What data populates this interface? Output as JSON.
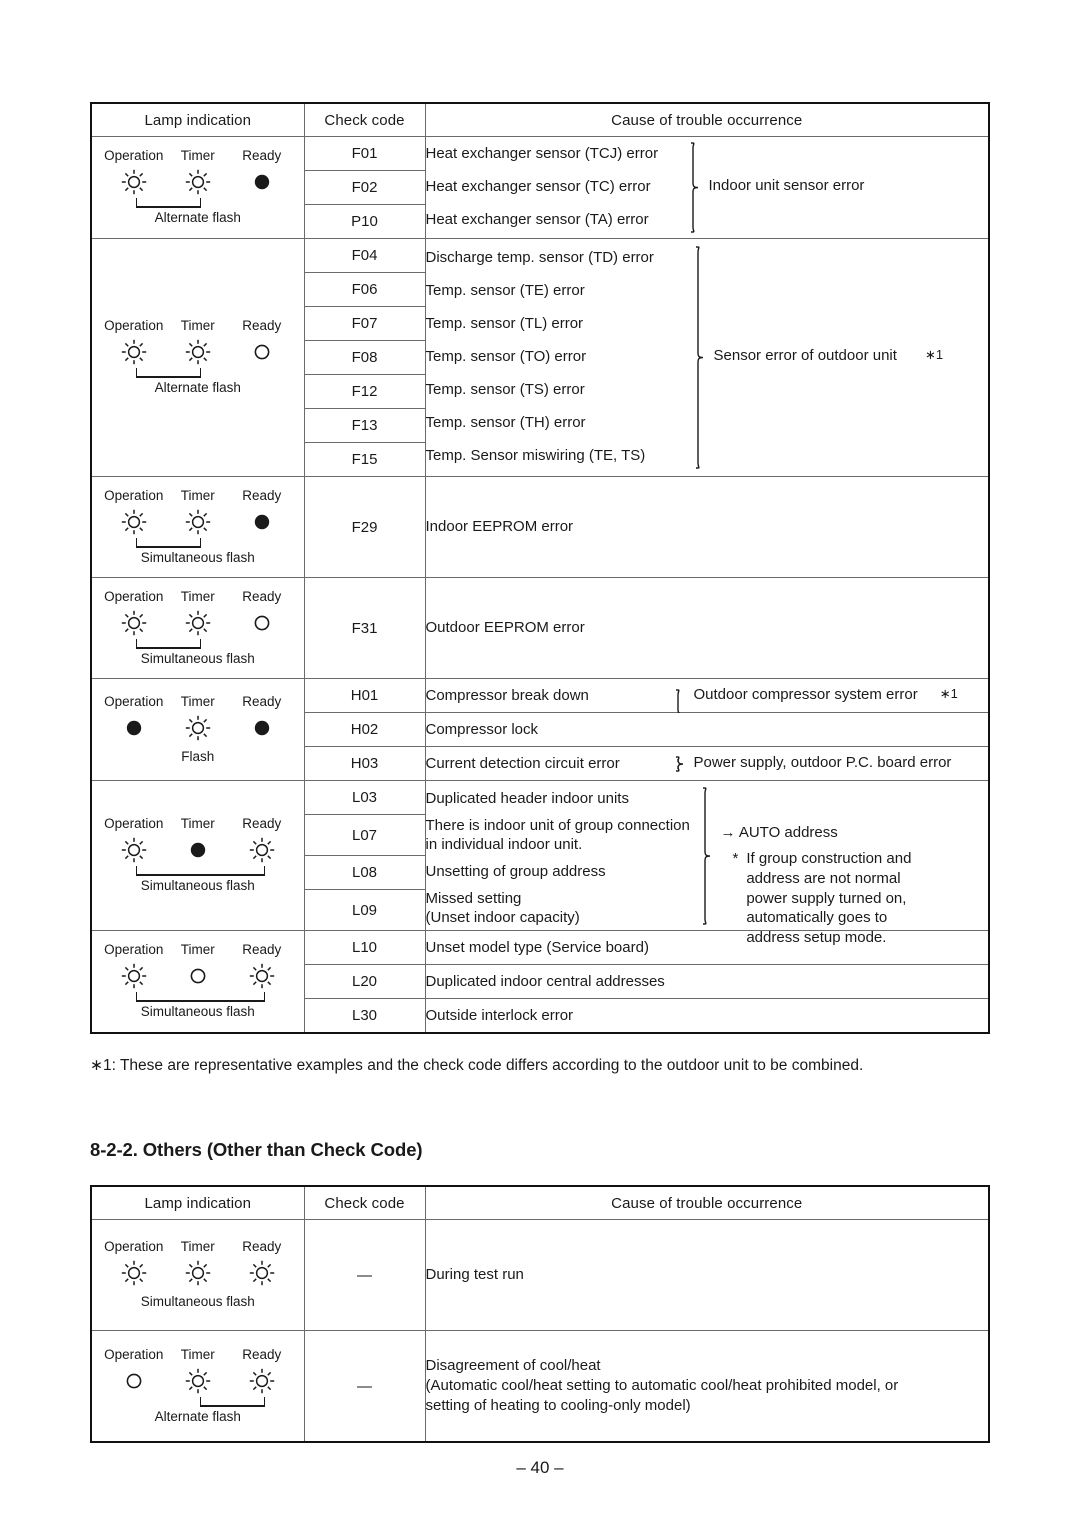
{
  "page": {
    "number": "– 40 –"
  },
  "table1": {
    "name": "check-code-table",
    "headers": [
      "Lamp indication",
      "Check code",
      "Cause of trouble occurrence"
    ],
    "groups": [
      {
        "id": "group-indoor-sensor",
        "lamp": {
          "labels": [
            "Operation",
            "Timer",
            "Ready"
          ],
          "icons": [
            "flash",
            "flash",
            "filled"
          ],
          "bracket": {
            "from": 0,
            "to": 1
          },
          "caption": "Alternate flash"
        },
        "rows": [
          {
            "code": "F01",
            "cause": "Heat exchanger sensor (TCJ) error"
          },
          {
            "code": "F02",
            "cause": "Heat exchanger sensor (TC) error"
          },
          {
            "code": "P10",
            "cause": "Heat exchanger sensor (TA) error"
          }
        ],
        "group_note": "Indoor unit sensor error",
        "group_note_star": "",
        "brace": true
      },
      {
        "id": "group-outdoor-sensor",
        "lamp": {
          "labels": [
            "Operation",
            "Timer",
            "Ready"
          ],
          "icons": [
            "flash",
            "flash",
            "open"
          ],
          "bracket": {
            "from": 0,
            "to": 1
          },
          "caption": "Alternate flash"
        },
        "rows": [
          {
            "code": "F04",
            "cause": "Discharge temp. sensor (TD) error"
          },
          {
            "code": "F06",
            "cause": "Temp. sensor (TE) error"
          },
          {
            "code": "F07",
            "cause": "Temp. sensor (TL) error"
          },
          {
            "code": "F08",
            "cause": "Temp. sensor (TO) error"
          },
          {
            "code": "F12",
            "cause": "Temp. sensor (TS) error"
          },
          {
            "code": "F13",
            "cause": "Temp. sensor (TH) error"
          },
          {
            "code": "F15",
            "cause": "Temp. Sensor miswiring (TE, TS)"
          }
        ],
        "group_note": "Sensor error of outdoor unit",
        "group_note_star": "∗1",
        "brace": true
      },
      {
        "id": "group-indoor-eeprom",
        "lamp": {
          "labels": [
            "Operation",
            "Timer",
            "Ready"
          ],
          "icons": [
            "flash",
            "flash",
            "filled"
          ],
          "bracket": {
            "from": 0,
            "to": 1
          },
          "caption": "Simultaneous flash"
        },
        "rows": [
          {
            "code": "F29",
            "cause": "Indoor EEPROM error"
          }
        ],
        "group_note": "",
        "group_note_star": "",
        "brace": false
      },
      {
        "id": "group-outdoor-eeprom",
        "lamp": {
          "labels": [
            "Operation",
            "Timer",
            "Ready"
          ],
          "icons": [
            "flash",
            "flash",
            "open"
          ],
          "bracket": {
            "from": 0,
            "to": 1
          },
          "caption": "Simultaneous flash"
        },
        "rows": [
          {
            "code": "F31",
            "cause": "Outdoor EEPROM error"
          }
        ],
        "group_note": "",
        "group_note_star": "",
        "brace": false
      },
      {
        "id": "group-compressor",
        "lamp": {
          "labels": [
            "Operation",
            "Timer",
            "Ready"
          ],
          "icons": [
            "filled",
            "flash",
            "filled"
          ],
          "bracket": null,
          "caption": "Flash"
        },
        "rows": [
          {
            "code": "H01",
            "cause": "Compressor break down"
          },
          {
            "code": "H02",
            "cause": "Compressor lock"
          },
          {
            "code": "H03",
            "cause": "Current detection circuit error"
          }
        ],
        "note_a": "Outdoor compressor system error",
        "note_a_star": "∗1",
        "note_b": "Power supply, outdoor P.C. board error"
      },
      {
        "id": "group-auto-address",
        "lamp": {
          "labels": [
            "Operation",
            "Timer",
            "Ready"
          ],
          "icons": [
            "flash",
            "filled",
            "flash"
          ],
          "bracket": {
            "from": 0,
            "to": 2
          },
          "caption": "Simultaneous flash"
        },
        "rows": [
          {
            "code": "L03",
            "cause": "Duplicated header indoor units"
          },
          {
            "code": "L07",
            "cause": "There is indoor unit of group connection\nin individual indoor unit."
          },
          {
            "code": "L08",
            "cause": "Unsetting of group address"
          },
          {
            "code": "L09",
            "cause": "Missed setting\n(Unset indoor capacity)"
          }
        ],
        "group_note": "→ AUTO address",
        "group_note_detail_star": "*",
        "group_note_detail": "If group construction and\naddress are not normal\npower supply turned on,\nautomatically goes to\naddress setup mode.",
        "brace": true
      },
      {
        "id": "group-unset-model",
        "lamp": {
          "labels": [
            "Operation",
            "Timer",
            "Ready"
          ],
          "icons": [
            "flash",
            "open",
            "flash"
          ],
          "bracket": {
            "from": 0,
            "to": 2
          },
          "caption": "Simultaneous flash"
        },
        "rows": [
          {
            "code": "L10",
            "cause": "Unset model type (Service board)"
          },
          {
            "code": "L20",
            "cause": "Duplicated indoor central addresses"
          },
          {
            "code": "L30",
            "cause": "Outside interlock error"
          }
        ],
        "group_note": "",
        "group_note_star": "",
        "brace": false
      }
    ],
    "footnote": "∗1:  These are representative examples and the check code differs according to the outdoor unit to be combined."
  },
  "section": {
    "heading": "8-2-2. Others (Other than Check Code)"
  },
  "table2": {
    "name": "others-table",
    "headers": [
      "Lamp indication",
      "Check code",
      "Cause of trouble occurrence"
    ],
    "rows": [
      {
        "id": "row-test-run",
        "lamp": {
          "labels": [
            "Operation",
            "Timer",
            "Ready"
          ],
          "icons": [
            "flash",
            "flash",
            "flash"
          ],
          "bracket": null,
          "caption": "Simultaneous flash"
        },
        "code": "—",
        "cause": "During test run"
      },
      {
        "id": "row-coolheat-disagreement",
        "lamp": {
          "labels": [
            "Operation",
            "Timer",
            "Ready"
          ],
          "icons": [
            "open",
            "flash",
            "flash"
          ],
          "bracket": {
            "from": 1,
            "to": 2
          },
          "caption": "Alternate flash"
        },
        "code": "—",
        "cause": "Disagreement of cool/heat\n(Automatic cool/heat setting to automatic cool/heat prohibited model, or\nsetting of heating to cooling-only model)"
      }
    ]
  }
}
